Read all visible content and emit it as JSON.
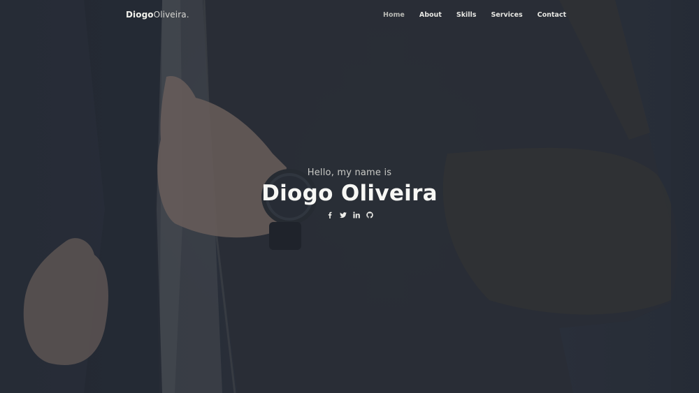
{
  "brand": {
    "first": "Diogo",
    "last": "Oliveira",
    "dot": "."
  },
  "nav": {
    "items": [
      {
        "label": "Home",
        "active": true
      },
      {
        "label": "About",
        "active": false
      },
      {
        "label": "Skills",
        "active": false
      },
      {
        "label": "Services",
        "active": false
      },
      {
        "label": "Contact",
        "active": false
      }
    ]
  },
  "hero": {
    "greeting": "Hello, my name is",
    "name": "Diogo Oliveira",
    "socials": [
      {
        "icon": "facebook-icon"
      },
      {
        "icon": "twitter-icon"
      },
      {
        "icon": "linkedin-icon"
      },
      {
        "icon": "github-icon"
      }
    ]
  },
  "colors": {
    "background": "#2a303a",
    "text": "#f7f7f4",
    "muted": "#c9cac6"
  }
}
